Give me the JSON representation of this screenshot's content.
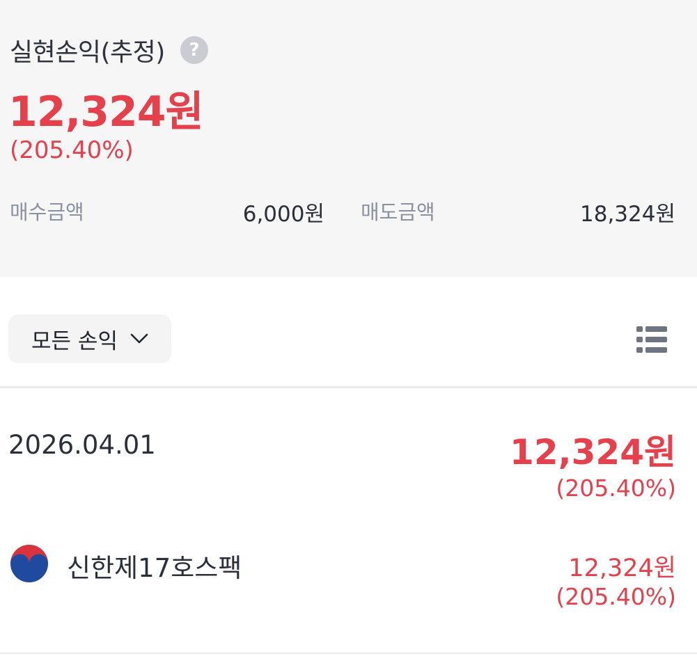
{
  "summary": {
    "title": "실현손익(추정)",
    "help_icon": "question-mark-icon",
    "amount": "12,324원",
    "rate": "(205.40%)",
    "buy_label": "매수금액",
    "buy_value": "6,000원",
    "sell_label": "매도금액",
    "sell_value": "18,324원"
  },
  "filter": {
    "label": "모든 손익",
    "dropdown_icon": "chevron-down-icon",
    "view_icon": "list-view-icon"
  },
  "entries": [
    {
      "date": "2026.04.01",
      "amount": "12,324원",
      "rate": "(205.40%)",
      "items": [
        {
          "flag": "korea-flag-icon",
          "name": "신한제17호스팩",
          "amount": "12,324원",
          "rate": "(205.40%)"
        }
      ]
    }
  ],
  "colors": {
    "profit": "#e5404b",
    "summary_bg": "#f6f6f7",
    "label_gray": "#8a91a0",
    "text_dark": "#2b2f3a"
  }
}
